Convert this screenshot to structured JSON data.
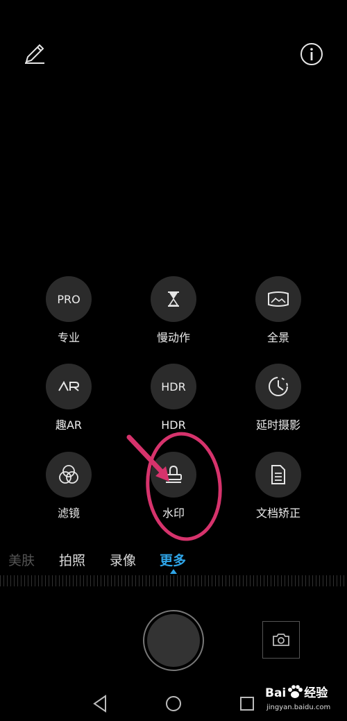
{
  "top_bar": {
    "edit_icon": "pencil-icon",
    "info_icon": "info-icon"
  },
  "modes": [
    {
      "id": "pro",
      "icon_text": "PRO",
      "label": "专业"
    },
    {
      "id": "slowmo",
      "icon": "hourglass-icon",
      "label": "慢动作"
    },
    {
      "id": "panorama",
      "icon": "panorama-icon",
      "label": "全景"
    },
    {
      "id": "ar",
      "icon_text": "AR",
      "label": "趣AR"
    },
    {
      "id": "hdr",
      "icon_text": "HDR",
      "label": "HDR"
    },
    {
      "id": "timelapse",
      "icon": "timelapse-icon",
      "label": "延时摄影"
    },
    {
      "id": "filter",
      "icon": "filter-icon",
      "label": "滤镜"
    },
    {
      "id": "watermark",
      "icon": "stamp-icon",
      "label": "水印"
    },
    {
      "id": "document",
      "icon": "document-icon",
      "label": "文档矫正"
    }
  ],
  "tabs": [
    {
      "label": "美肤",
      "state": "faded"
    },
    {
      "label": "拍照",
      "state": "normal"
    },
    {
      "label": "录像",
      "state": "normal"
    },
    {
      "label": "更多",
      "state": "active"
    }
  ],
  "annotation": {
    "color": "#d6336c"
  },
  "watermark": {
    "brand": "Bai",
    "brand2": "经验",
    "url": "jingyan.baidu.com"
  },
  "colors": {
    "accent": "#2fa5e8",
    "button_bg": "#2b2b2b"
  }
}
